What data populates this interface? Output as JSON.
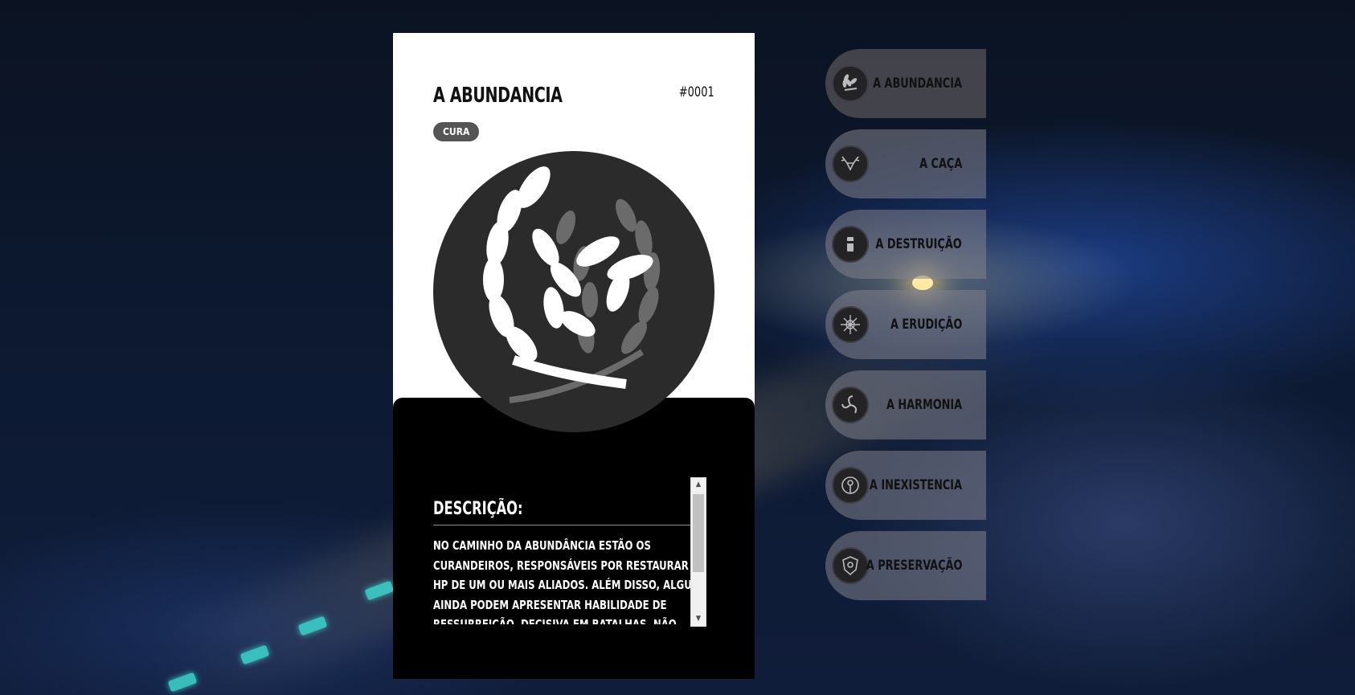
{
  "card": {
    "title": "A ABUNDANCIA",
    "id": "#0001",
    "tag": "CURA",
    "emblem_icon": "wheat-laurel-icon",
    "description_title": "DESCRIÇÃO:",
    "description": "NO CAMINHO DA ABUNDÂNCIA ESTÃO OS CURANDEIROS, RESPONSÁVEIS POR RESTAURAR O HP DE UM OU MAIS ALIADOS. ALÉM DISSO, ALGUNS AINDA PODEM APRESENTAR HABILIDADE DE RESSURREIÇÃO, DECISIVA EM BATALHAS. NÃO POSSUEM FOCO EM DANO, MAS APRESENTAM TAXAS DE"
  },
  "paths": [
    {
      "label": "A ABUNDANCIA",
      "icon": "wheat-icon",
      "active": true
    },
    {
      "label": "A CAÇA",
      "icon": "stag-icon",
      "active": false
    },
    {
      "label": "A DESTRUIÇÃO",
      "icon": "hammer-icon",
      "active": false
    },
    {
      "label": "A ERUDIÇÃO",
      "icon": "star-orb-icon",
      "active": false
    },
    {
      "label": "A HARMONIA",
      "icon": "triskele-icon",
      "active": false
    },
    {
      "label": "A INEXISTENCIA",
      "icon": "eye-ring-icon",
      "active": false
    },
    {
      "label": "A PRESERVAÇÃO",
      "icon": "shield-crest-icon",
      "active": false
    }
  ],
  "colors": {
    "active_item": "#48484e",
    "inactive_item": "#82828c",
    "card_lower": "#000000",
    "tag": "#555555"
  }
}
